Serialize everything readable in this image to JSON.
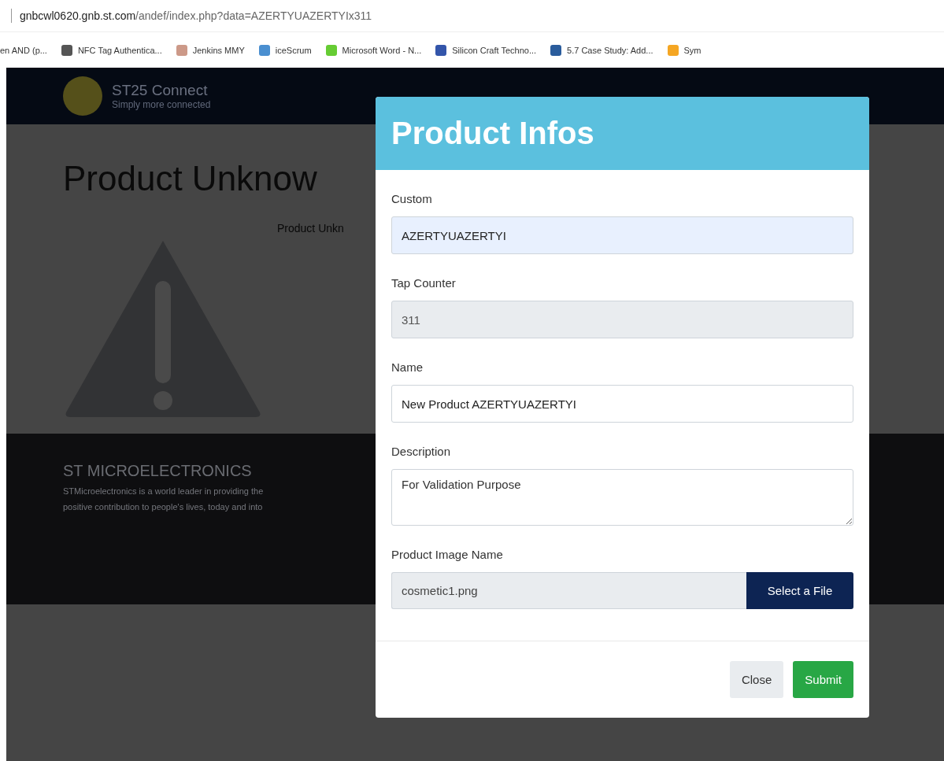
{
  "browser": {
    "url_host": "gnbcwl0620.gnb.st.com",
    "url_path": "/andef/index.php?data=AZERTYUAZERTYIx311",
    "bookmarks": [
      {
        "label": "en AND (p..."
      },
      {
        "label": "NFC Tag Authentica..."
      },
      {
        "label": "Jenkins MMY"
      },
      {
        "label": "iceScrum"
      },
      {
        "label": "Microsoft Word - N..."
      },
      {
        "label": "Silicon Craft Techno..."
      },
      {
        "label": "5.7 Case Study: Add..."
      },
      {
        "label": "Sym"
      }
    ]
  },
  "navbar": {
    "title": "ST25 Connect",
    "subtitle": "Simply more connected"
  },
  "page": {
    "heading": "Product Unknow",
    "message": "Product Unkn",
    "footer": {
      "title": "ST MICROELECTRONICS",
      "lines": [
        "STMicroelectronics is a world leader in providing the",
        "positive contribution to people's lives, today and into"
      ]
    }
  },
  "modal": {
    "title": "Product Infos",
    "fields": [
      {
        "label": "Custom",
        "kind": "input",
        "value": "AZERTYUAZERTYI",
        "disabled": false,
        "autofilled": true
      },
      {
        "label": "Tap Counter",
        "kind": "input",
        "value": "311",
        "disabled": true,
        "autofilled": false
      },
      {
        "label": "Name",
        "kind": "input",
        "value": "New Product AZERTYUAZERTYI",
        "disabled": false,
        "autofilled": false
      },
      {
        "label": "Description",
        "kind": "textarea",
        "value": "For Validation Purpose",
        "disabled": false,
        "autofilled": false
      },
      {
        "label": "Product Image Name",
        "kind": "file",
        "value": "cosmetic1.png",
        "button": "Select a File",
        "disabled": true,
        "autofilled": false
      }
    ],
    "buttons": [
      {
        "label": "Close",
        "kind": "secondary"
      },
      {
        "label": "Submit",
        "kind": "success"
      }
    ]
  }
}
